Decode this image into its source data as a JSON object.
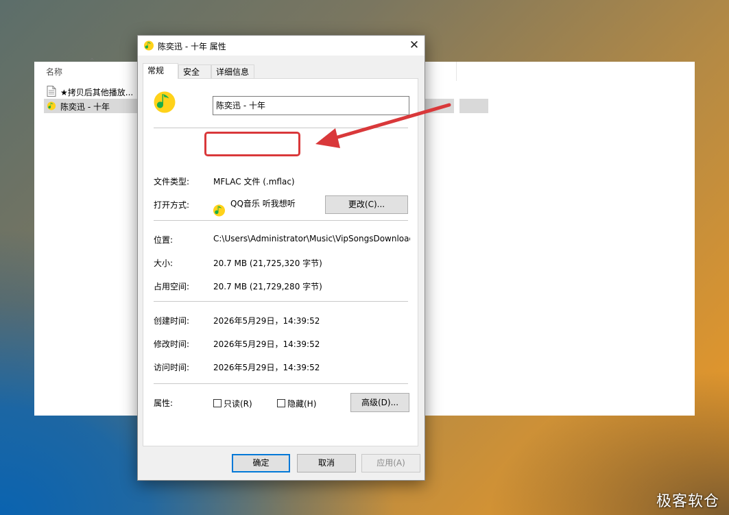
{
  "explorer": {
    "column_header": "名称",
    "files": [
      {
        "name": "★拷贝后其他播放...",
        "icon": "document-icon"
      },
      {
        "name": "陈奕迅 - 十年",
        "icon": "qq-music-icon",
        "selected": true
      }
    ]
  },
  "dialog": {
    "title": "陈奕迅 - 十年 属性",
    "close_label": "✕",
    "tabs": [
      "常规",
      "安全",
      "详细信息"
    ],
    "active_tab": "常规",
    "file_name": "陈奕迅 - 十年",
    "file_type_label": "文件类型:",
    "file_type_value": "MFLAC 文件 (.mflac)",
    "open_with_label": "打开方式:",
    "open_with_app": "QQ音乐 听我想听",
    "change_button": "更改(C)...",
    "location_label": "位置:",
    "location_value": "C:\\Users\\Administrator\\Music\\VipSongsDownload",
    "size_label": "大小:",
    "size_value": "20.7 MB (21,725,320 字节)",
    "size_on_disk_label": "占用空间:",
    "size_on_disk_value": "20.7 MB (21,729,280 字节)",
    "created_label": "创建时间:",
    "created_value": "2026年5月29日，14:39:52",
    "modified_label": "修改时间:",
    "modified_value": "2026年5月29日，14:39:52",
    "accessed_label": "访问时间:",
    "accessed_value": "2026年5月29日，14:39:52",
    "attributes_label": "属性:",
    "readonly_label": "只读(R)",
    "readonly_checked": false,
    "hidden_label": "隐藏(H)",
    "hidden_checked": false,
    "advanced_button": "高级(D)...",
    "ok_button": "确定",
    "cancel_button": "取消",
    "apply_button": "应用(A)"
  },
  "annotation": {
    "color": "#d9383a"
  },
  "watermark": "极客软仓",
  "colors": {
    "accent": "#0078d7",
    "qq_green": "#1aad4a",
    "qq_yellow": "#ffd21a"
  }
}
